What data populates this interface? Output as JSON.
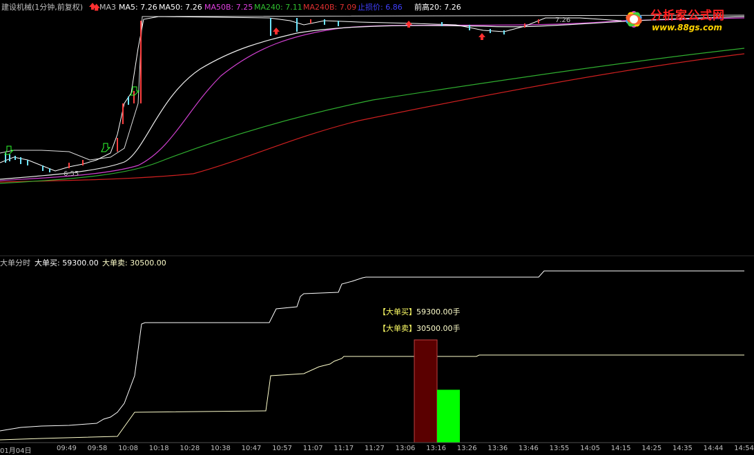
{
  "header": {
    "stock_title": "建设机械(1分钟,前复权)",
    "ma3_label": "MA3",
    "ma5": "MA5: 7.26",
    "ma50": "MA50: 7.26",
    "ma50b": "MA50B: 7.25",
    "ma240": "MA240: 7.11",
    "ma240b": "MA240B: 7.09",
    "stop_loss": "止损价: 6.86",
    "prev_high": "前高20: 7.26"
  },
  "colors": {
    "ma5": "#ffffff",
    "ma50": "#ffffff",
    "ma50b": "#e040e0",
    "ma240": "#30c030",
    "ma240b": "#e03030",
    "stop_loss": "#4040ff",
    "big_buy_bar": "#5a0000",
    "big_sell_bar": "#00ff00",
    "up_arrow": "#ff3030"
  },
  "price_chart": {
    "low_label": "6.55",
    "high_label": "7.26"
  },
  "indicator": {
    "title": "大单分时",
    "buy_label": "大单买: 59300.00",
    "sell_label": "大单卖: 30500.00",
    "annot_buy_tag": "【大单买】",
    "annot_buy_value": "59300.00手",
    "annot_sell_tag": "【大单卖】",
    "annot_sell_value": "30500.00手"
  },
  "chart_data": {
    "type": "bar",
    "categories": [
      "大单买",
      "大单卖"
    ],
    "values": [
      59300,
      30500
    ],
    "ylim": [
      0,
      59300
    ]
  },
  "xaxis": {
    "date": "01月04日",
    "ticks": [
      "09:49",
      "09:58",
      "10:08",
      "10:18",
      "10:28",
      "10:38",
      "10:47",
      "10:57",
      "11:07",
      "11:17",
      "11:27",
      "13:06",
      "13:16",
      "13:26",
      "13:36",
      "13:46",
      "13:55",
      "14:05",
      "14:15",
      "14:25",
      "14:35",
      "14:44",
      "14:54"
    ]
  },
  "logo": {
    "title": "分析家公式网",
    "url": "www.88gs.com"
  }
}
